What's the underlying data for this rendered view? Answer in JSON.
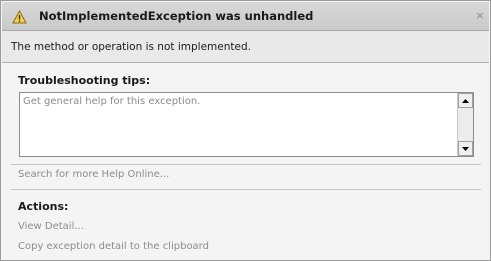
{
  "dialog": {
    "title": "NotImplementedException was unhandled",
    "close_glyph": "×",
    "message": "The method or operation is not implemented."
  },
  "troubleshooting": {
    "heading": "Troubleshooting tips:",
    "tips": [
      "Get general help for this exception."
    ],
    "search_link": "Search for more Help Online..."
  },
  "actions": {
    "heading": "Actions:",
    "items": [
      "View Detail...",
      "Copy exception detail to the clipboard"
    ]
  },
  "icons": {
    "header": "warning-icon",
    "scroll_up": "arrow-up-icon",
    "scroll_down": "arrow-down-icon"
  }
}
